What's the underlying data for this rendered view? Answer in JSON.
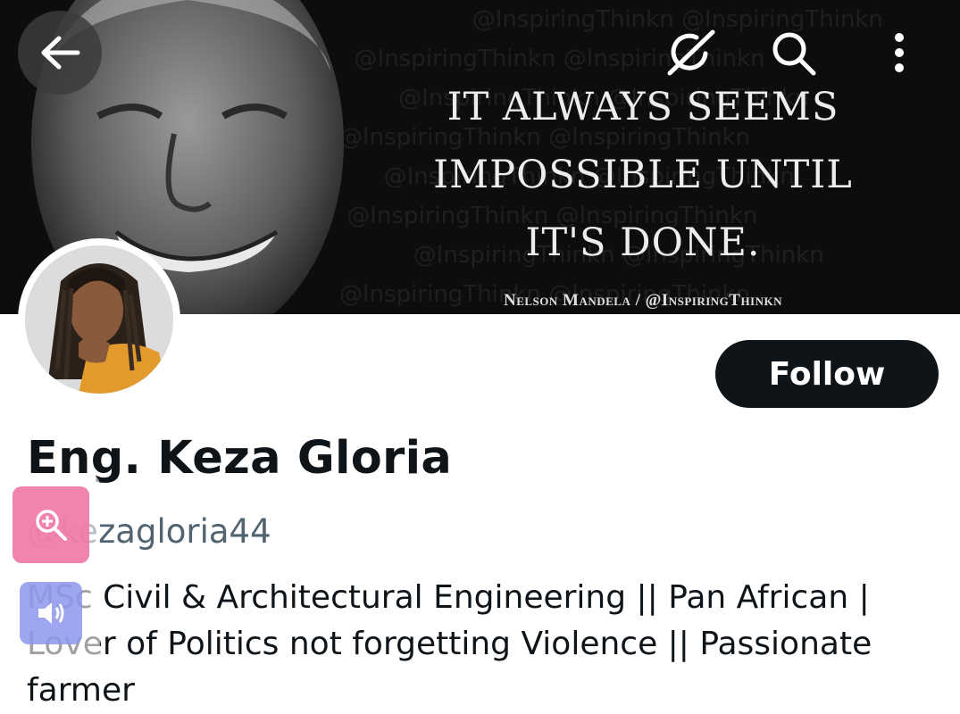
{
  "banner": {
    "quote_lines": [
      "IT ALWAYS SEEMS",
      "IMPOSSIBLE UNTIL",
      "IT'S DONE."
    ],
    "attribution": "Nelson Mandela / @InspiringThinkn",
    "watermark": "@InspiringThinkn"
  },
  "toolbar": {
    "back_icon": "arrow-left-icon",
    "grok_icon": "grok-icon",
    "search_icon": "search-icon",
    "more_icon": "more-vertical-icon"
  },
  "profile": {
    "display_name": "Eng. Keza Gloria",
    "handle": "@kezagloria44",
    "bio": "MSc Civil & Architectural Engineering ||  Pan African | Lover of Politics not forgetting Violence || Passionate farmer",
    "follow_label": "Follow"
  },
  "overlay_tools": {
    "zoom_icon": "zoom-in-icon",
    "audio_icon": "speaker-icon"
  }
}
